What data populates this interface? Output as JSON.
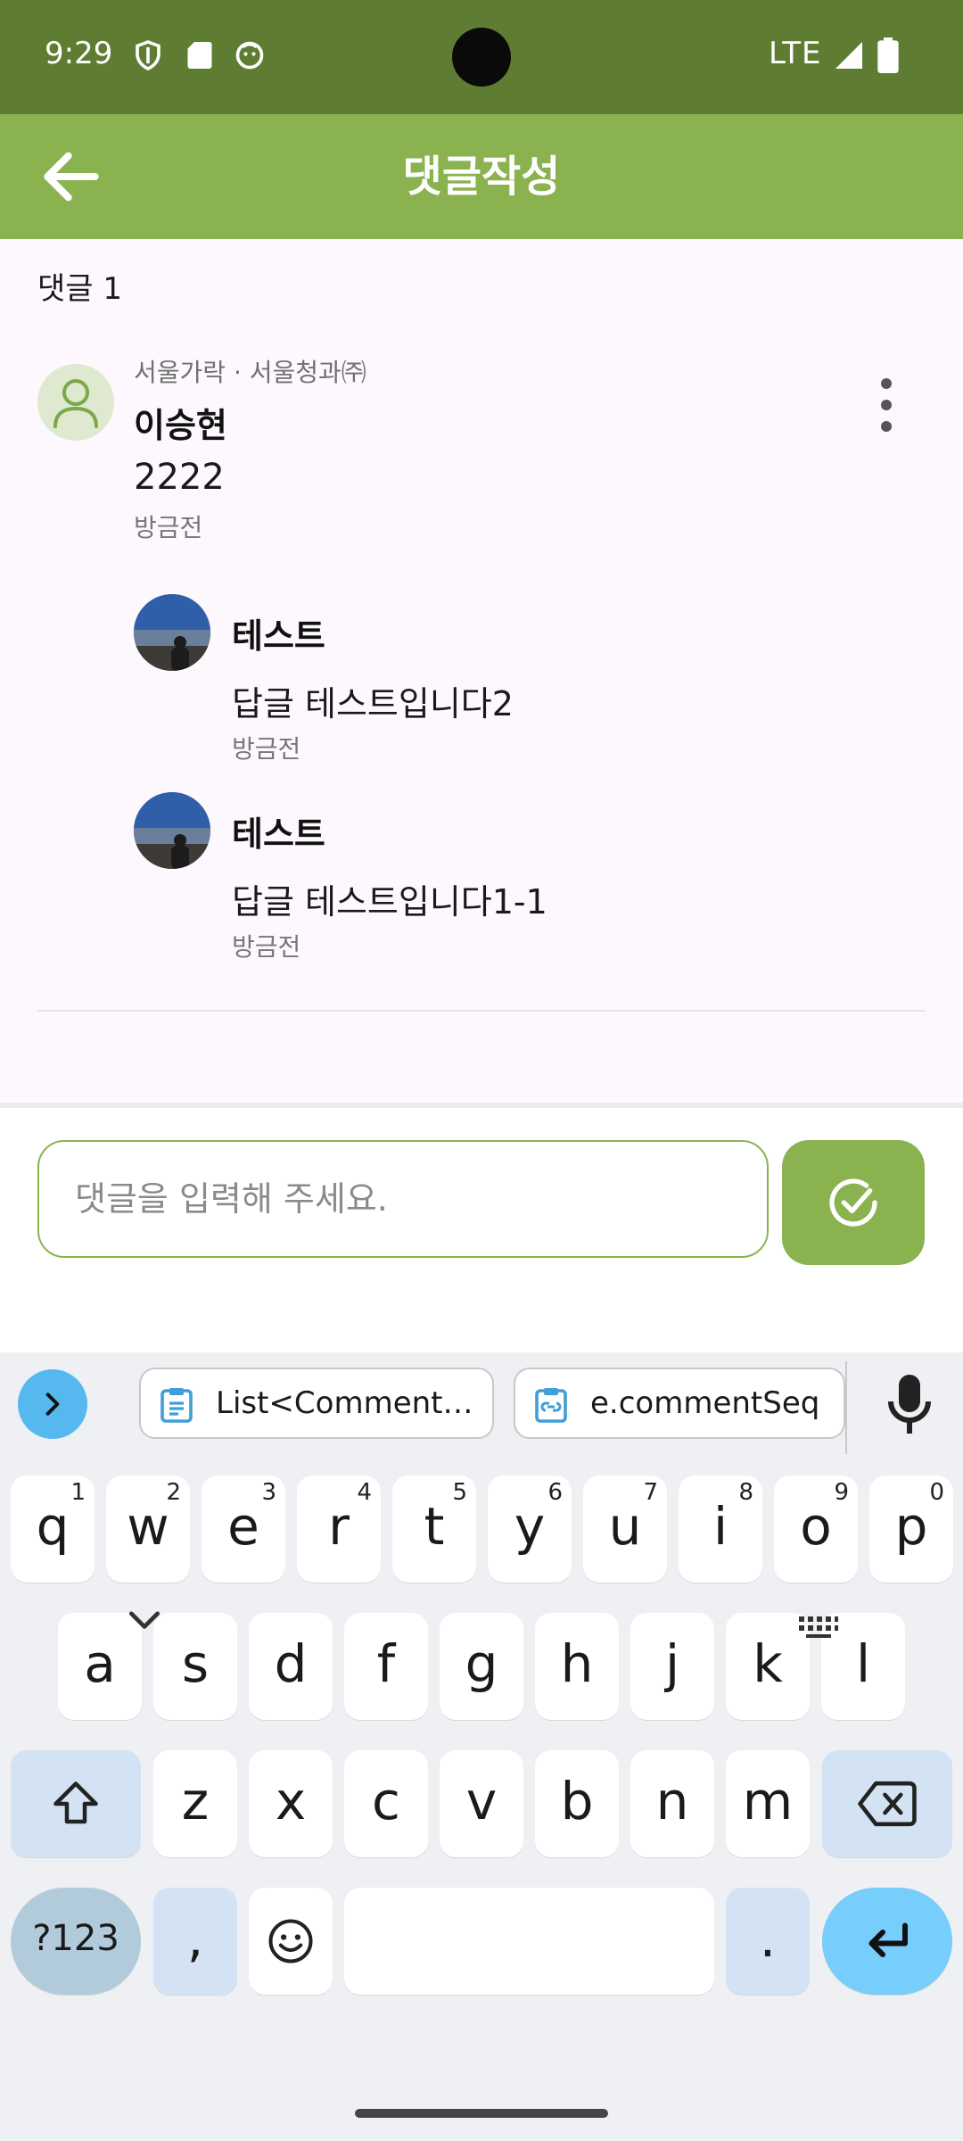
{
  "status_bar": {
    "time": "9:29",
    "network": "LTE",
    "icons": [
      "shield-icon",
      "sd-card-icon",
      "face-icon",
      "signal-icon",
      "battery-icon"
    ]
  },
  "app_bar": {
    "title": "댓글작성",
    "back_icon": "arrow-left-icon"
  },
  "comments": {
    "count_label": "댓글 1",
    "main": {
      "org": "서울가락 · 서울청과㈜",
      "author": "이승현",
      "text": "2222",
      "time": "방금전"
    },
    "replies": [
      {
        "author": "테스트",
        "text": "답글 테스트입니다2",
        "time": "방금전"
      },
      {
        "author": "테스트",
        "text": "답글 테스트입니다1-1",
        "time": "방금전"
      }
    ]
  },
  "input": {
    "placeholder": "댓글을 입력해 주세요.",
    "value": ""
  },
  "keyboard": {
    "clipboard": [
      "List<Comment…",
      "e.commentSeq"
    ],
    "row1": [
      {
        "k": "q",
        "h": "1"
      },
      {
        "k": "w",
        "h": "2"
      },
      {
        "k": "e",
        "h": "3"
      },
      {
        "k": "r",
        "h": "4"
      },
      {
        "k": "t",
        "h": "5"
      },
      {
        "k": "y",
        "h": "6"
      },
      {
        "k": "u",
        "h": "7"
      },
      {
        "k": "i",
        "h": "8"
      },
      {
        "k": "o",
        "h": "9"
      },
      {
        "k": "p",
        "h": "0"
      }
    ],
    "row2": [
      "a",
      "s",
      "d",
      "f",
      "g",
      "h",
      "j",
      "k",
      "l"
    ],
    "row3": [
      "z",
      "x",
      "c",
      "v",
      "b",
      "n",
      "m"
    ],
    "row4": {
      "symbols": "?123",
      "comma": ",",
      "period": "."
    },
    "colors": {
      "key": "#ffffff",
      "special": "#d3e3f4",
      "enter": "#77cdfb",
      "accent": "#8ab24f"
    }
  }
}
